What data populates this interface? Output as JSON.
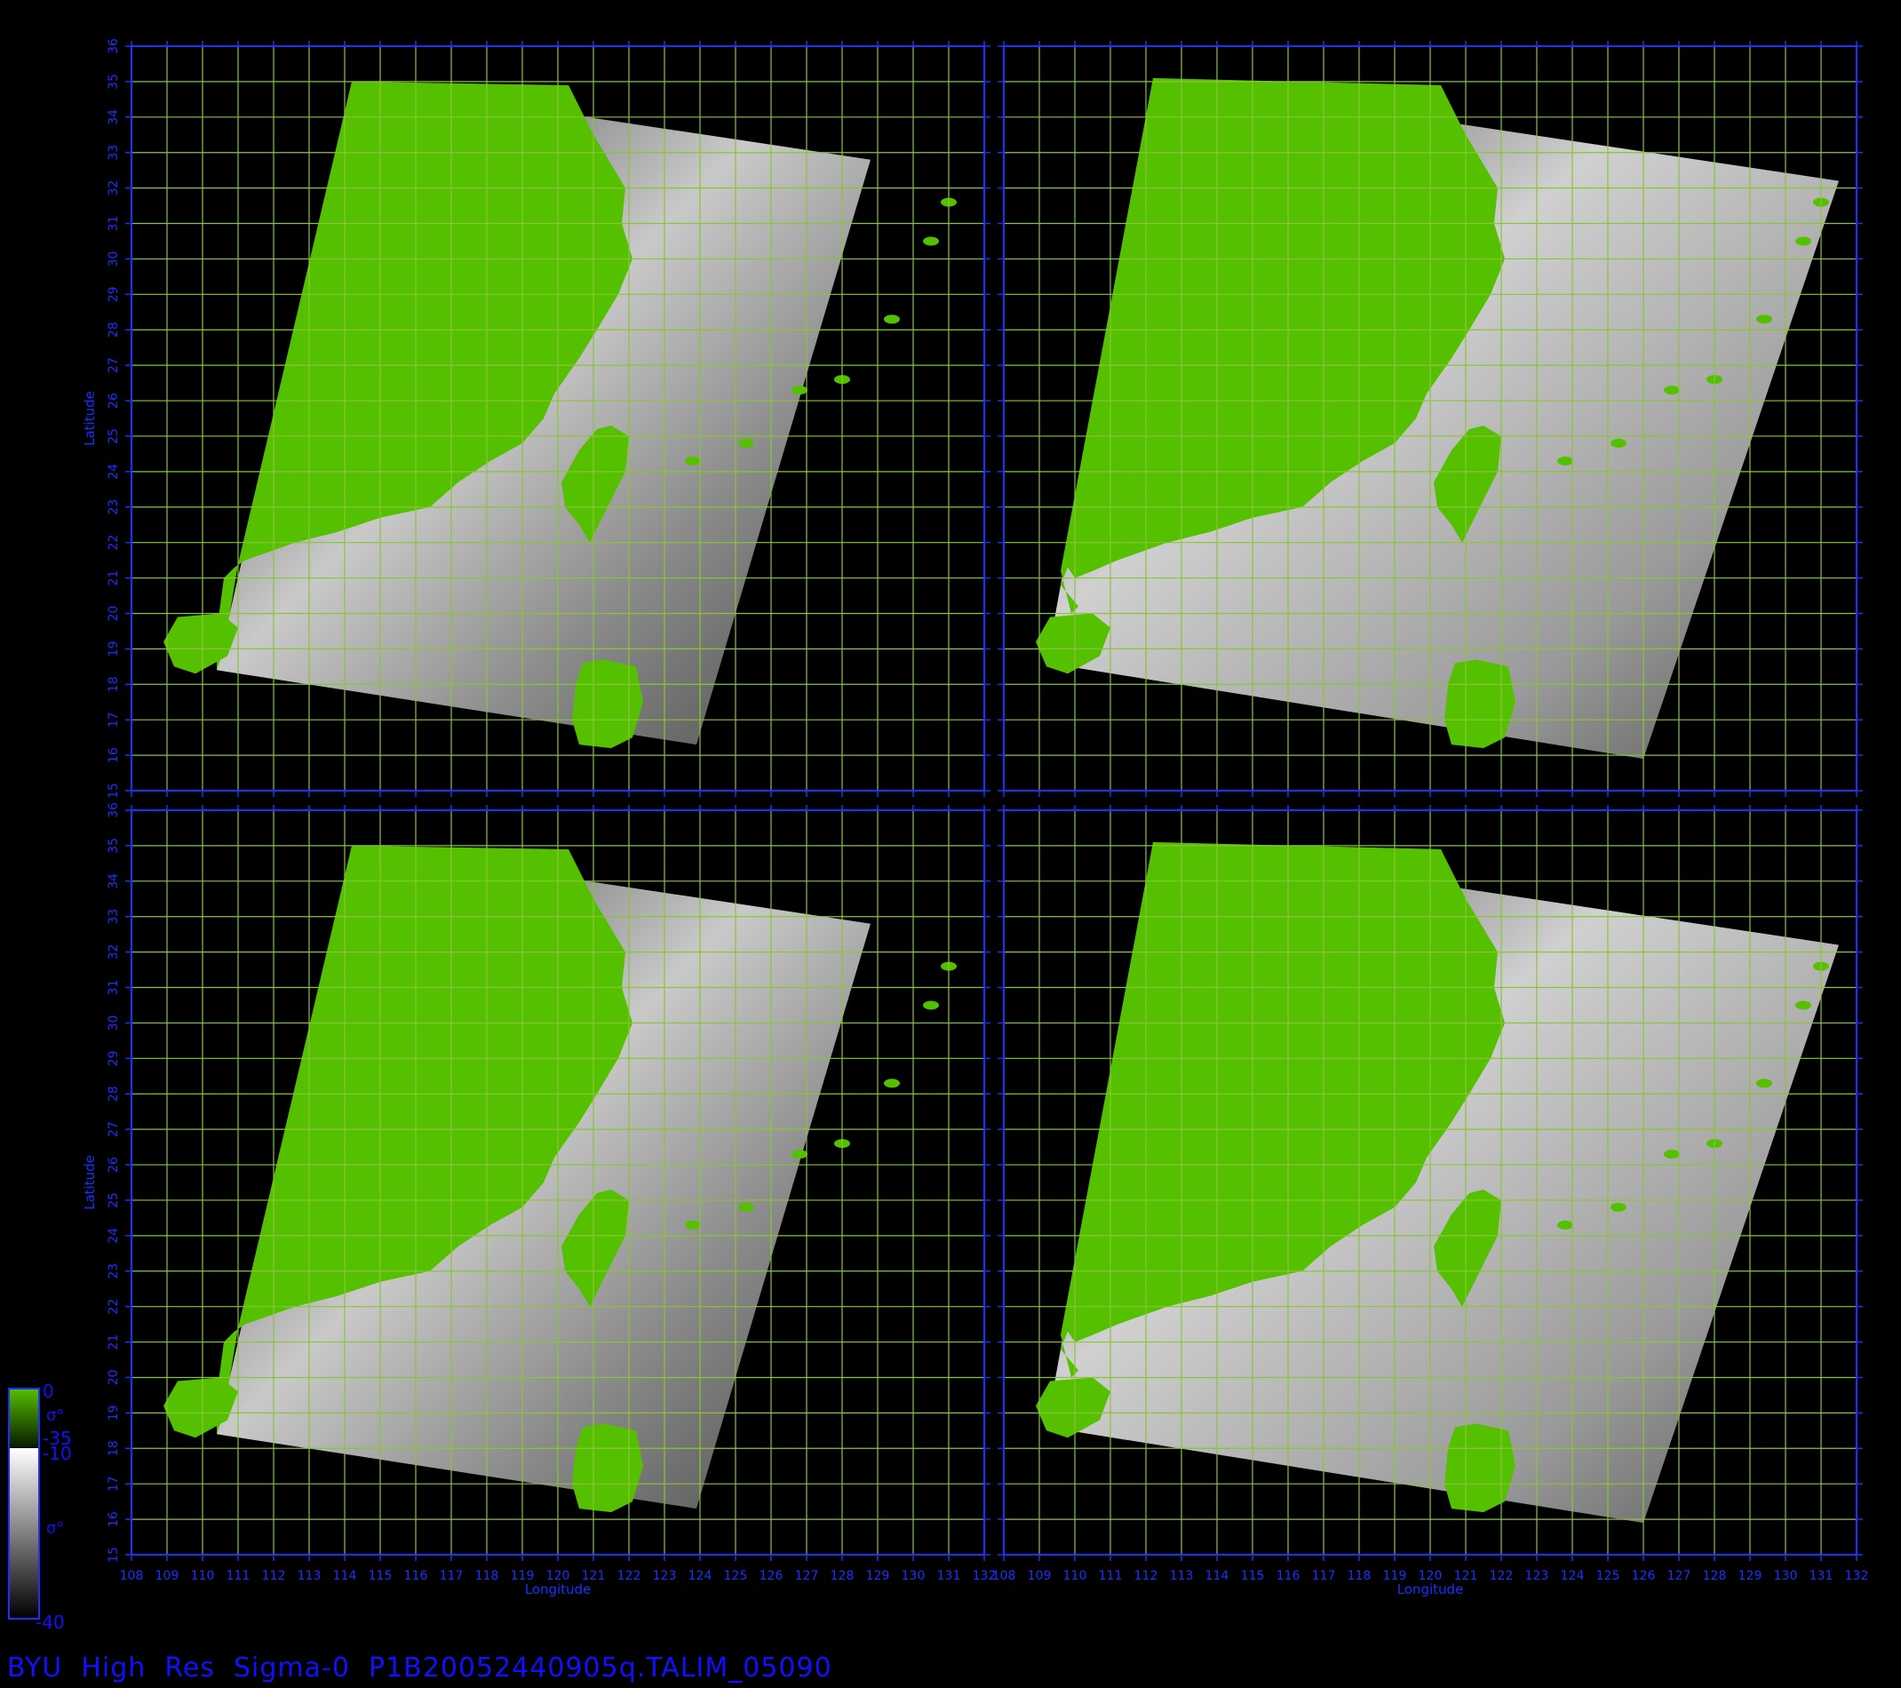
{
  "footer": {
    "title": "BYU  High  Res  Sigma-0  P1B20052440905q.TALIM_05090"
  },
  "axes": {
    "xlabel": "Longitude",
    "ylabel": "Latitude",
    "lon_ticks": [
      "108",
      "109",
      "110",
      "111",
      "112",
      "113",
      "114",
      "115",
      "116",
      "117",
      "118",
      "119",
      "120",
      "121",
      "122",
      "123",
      "124",
      "125",
      "126",
      "127",
      "128",
      "129",
      "130",
      "131",
      "132"
    ],
    "lat_ticks": [
      "15",
      "16",
      "17",
      "18",
      "19",
      "20",
      "21",
      "22",
      "23",
      "24",
      "25",
      "26",
      "27",
      "28",
      "29",
      "30",
      "31",
      "32",
      "33",
      "34",
      "35",
      "36"
    ],
    "lon_range": [
      108,
      132
    ],
    "lat_range": [
      15,
      36
    ]
  },
  "colorbar": {
    "land": {
      "top": "0",
      "symbol": "σ°",
      "bottom": "-35"
    },
    "ocean": {
      "top": "-10",
      "symbol": "σ°",
      "bottom": "-40"
    }
  },
  "colors": {
    "axis": "#1a30ff",
    "grid": "#8ac43a",
    "land": "#55c000",
    "ocean_light": "#dddddd",
    "ocean_dark": "#3a3a3a",
    "background": "#000000"
  },
  "panels": [
    {
      "id": "panel-top-left"
    },
    {
      "id": "panel-top-right"
    },
    {
      "id": "panel-bottom-left"
    },
    {
      "id": "panel-bottom-right"
    }
  ]
}
